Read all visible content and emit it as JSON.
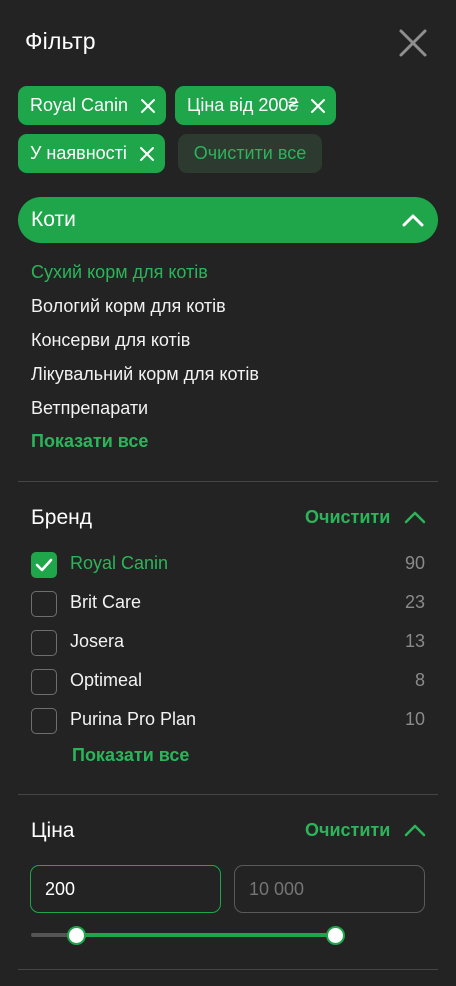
{
  "header": {
    "title": "Фільтр"
  },
  "chips": [
    {
      "label": "Royal Canin"
    },
    {
      "label": "Ціна від 200₴"
    },
    {
      "label": "У наявності"
    }
  ],
  "clear_all_label": "Очистити все",
  "category": {
    "title": "Коти",
    "items": [
      {
        "label": "Сухий корм для котів",
        "active": true
      },
      {
        "label": "Вологий корм для котів",
        "active": false
      },
      {
        "label": "Консерви для котів",
        "active": false
      },
      {
        "label": "Лікувальний корм для котів",
        "active": false
      },
      {
        "label": "Ветпрепарати",
        "active": false
      }
    ],
    "show_all_label": "Показати все"
  },
  "brand": {
    "title": "Бренд",
    "clear_label": "Очистити",
    "items": [
      {
        "name": "Royal Canin",
        "count": "90",
        "checked": true
      },
      {
        "name": "Brit Care",
        "count": "23",
        "checked": false
      },
      {
        "name": "Josera",
        "count": "13",
        "checked": false
      },
      {
        "name": "Optimeal",
        "count": "8",
        "checked": false
      },
      {
        "name": "Purina Pro Plan",
        "count": "10",
        "checked": false
      }
    ],
    "show_all_label": "Показати все"
  },
  "price": {
    "title": "Ціна",
    "clear_label": "Очистити",
    "min_value": "200",
    "max_placeholder": "10 000"
  },
  "colors": {
    "background": "#232323",
    "accent": "#1fa64b",
    "accent_text": "#2bb55a",
    "muted": "#8a8a8a"
  }
}
